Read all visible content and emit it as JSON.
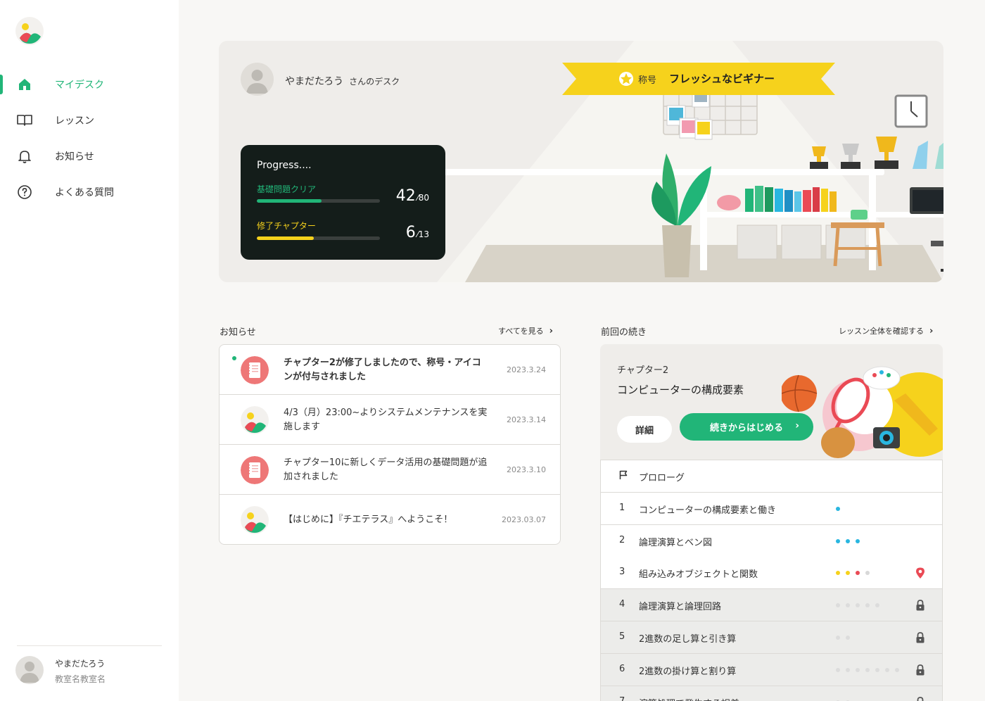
{
  "sidebar": {
    "items": [
      {
        "label": "マイデスク",
        "icon": "home-icon",
        "active": true
      },
      {
        "label": "レッスン",
        "icon": "book-icon",
        "active": false
      },
      {
        "label": "お知らせ",
        "icon": "bell-icon",
        "active": false
      },
      {
        "label": "よくある質問",
        "icon": "question-icon",
        "active": false
      }
    ],
    "user": {
      "name": "やまだたろう",
      "school": "教室名教室名"
    }
  },
  "hero": {
    "user_name": "やまだたろう",
    "desk_suffix": "さんのデスク",
    "title_label": "称号",
    "title_value": "フレッシュなビギナー",
    "progress": {
      "heading": "Progress....",
      "basic": {
        "label": "基礎問題クリア",
        "value": "42",
        "total": "80",
        "color": "#21b578"
      },
      "chapter": {
        "label": "修了チャプター",
        "value": "6",
        "total": "13",
        "color": "#f6d21c"
      }
    }
  },
  "news": {
    "heading": "お知らせ",
    "see_all": "すべてを見る",
    "items": [
      {
        "text": "チャプター2が修了しましたので、称号・アイコンが付与されました",
        "date": "2023.3.24",
        "icon": "document-icon",
        "unread": true
      },
      {
        "text": "4/3（月）23:00~よりシステムメンテナンスを実施します",
        "date": "2023.3.14",
        "icon": "logo-icon",
        "unread": false
      },
      {
        "text": "チャプター10に新しくデータ活用の基礎問題が追加されました",
        "date": "2023.3.10",
        "icon": "document-icon",
        "unread": false
      },
      {
        "text": "【はじめに】『チエテラス』へようこそ！",
        "date": "2023.03.07",
        "icon": "logo-icon",
        "unread": false
      }
    ]
  },
  "continue": {
    "heading": "前回の続き",
    "all_lessons": "レッスン全体を確認する",
    "chapter": "チャプター2",
    "title": "コンピューターの構成要素",
    "detail_button": "詳細",
    "continue_button": "続きからはじめる"
  },
  "lessons": [
    {
      "num": "",
      "title": "プロローグ",
      "status": "prologue",
      "dots": []
    },
    {
      "num": "1",
      "title": "コンピューターの構成要素と働き",
      "status": "open",
      "dots": [
        "#29b6e0"
      ]
    },
    {
      "num": "2",
      "title": "論理演算とベン図",
      "status": "open",
      "dots": [
        "#29b6e0",
        "#29b6e0",
        "#29b6e0"
      ]
    },
    {
      "num": "3",
      "title": "組み込みオブジェクトと関数",
      "status": "current",
      "dots": [
        "#f6d21c",
        "#f6d21c",
        "#ea4a55",
        "#d8d8d8"
      ]
    },
    {
      "num": "4",
      "title": "論理演算と論理回路",
      "status": "locked",
      "dots": [
        "#dcdcdc",
        "#dcdcdc",
        "#dcdcdc",
        "#dcdcdc",
        "#dcdcdc"
      ]
    },
    {
      "num": "5",
      "title": "2進数の足し算と引き算",
      "status": "locked",
      "dots": [
        "#dcdcdc",
        "#dcdcdc"
      ]
    },
    {
      "num": "6",
      "title": "2進数の掛け算と割り算",
      "status": "locked",
      "dots": [
        "#dcdcdc",
        "#dcdcdc",
        "#dcdcdc",
        "#dcdcdc",
        "#dcdcdc",
        "#dcdcdc",
        "#dcdcdc"
      ]
    },
    {
      "num": "7",
      "title": "演算処理で発生する誤差",
      "status": "locked",
      "dots": [
        "#dcdcdc",
        "#dcdcdc"
      ]
    }
  ],
  "colors": {
    "accent": "#21b578",
    "yellow": "#f6d21c",
    "red": "#ea4a55",
    "blue": "#29b6e0"
  }
}
